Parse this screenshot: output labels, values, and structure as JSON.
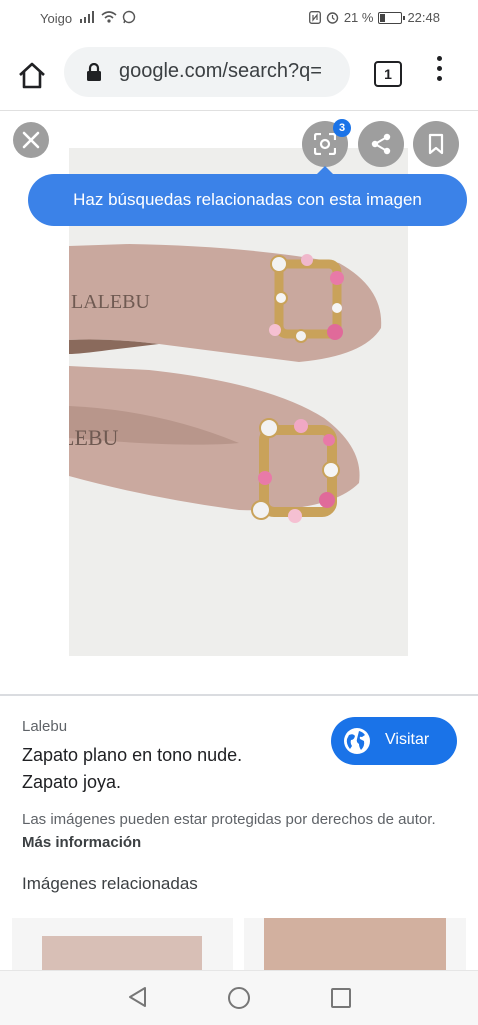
{
  "status_bar": {
    "carrier": "Yoigo",
    "battery": "21 %",
    "time": "22:48"
  },
  "browser": {
    "url": "google.com/search?q=",
    "tab_count": "1"
  },
  "viewer": {
    "lens_badge": "3",
    "tooltip": "Haz búsquedas relacionadas con esta imagen",
    "brand_text_top": "LALEBU",
    "brand_text_bottom": "LEBU"
  },
  "result": {
    "source": "Lalebu",
    "title_line1": "Zapato plano en tono nude.",
    "title_line2": "Zapato joya.",
    "visit_label": "Visitar",
    "copyright_text": "Las imágenes pueden estar protegidas por derechos de autor.",
    "more_info": "Más información"
  },
  "related": {
    "heading": "Imágenes relacionadas"
  },
  "colors": {
    "accent": "#1a73e8",
    "tooltip": "#3b82e8",
    "shoe": "#c9a89e"
  },
  "icons": [
    "home-icon",
    "lock-icon",
    "tabs-icon",
    "more-vert-icon",
    "close-icon",
    "lens-icon",
    "share-icon",
    "bookmark-icon",
    "globe-icon",
    "nav-back-icon",
    "nav-home-icon",
    "nav-recent-icon"
  ]
}
